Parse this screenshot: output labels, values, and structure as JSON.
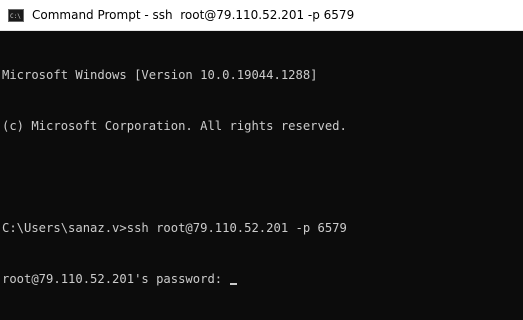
{
  "window": {
    "title": "Command Prompt - ssh  root@79.110.52.201 -p 6579",
    "icon": "command-prompt-icon"
  },
  "console": {
    "lines": [
      "Microsoft Windows [Version 10.0.19044.1288]",
      "(c) Microsoft Corporation. All rights reserved.",
      "",
      "C:\\Users\\sanaz.v>ssh root@79.110.52.201 -p 6579",
      "root@79.110.52.201's password: "
    ]
  },
  "colors": {
    "background": "#0c0c0c",
    "text": "#cccccc",
    "titlebar": "#ffffff"
  }
}
